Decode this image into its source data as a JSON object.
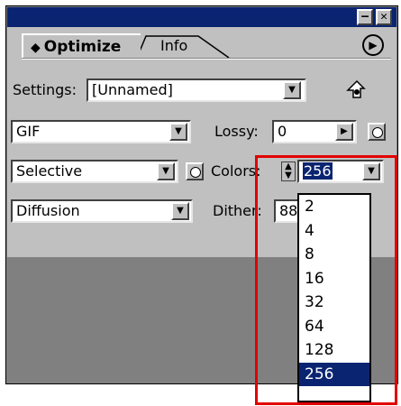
{
  "window": {
    "minimize_glyph": "–",
    "close_glyph": "✕"
  },
  "tabs": {
    "active_label": "Optimize",
    "active_glyph": "◆",
    "inactive_label": "Info",
    "menu_glyph": "▶"
  },
  "settings": {
    "label": "Settings:",
    "value": "[Unnamed]"
  },
  "format": {
    "value": "GIF"
  },
  "lossy": {
    "label": "Lossy:",
    "value": "0",
    "arrow": "▶"
  },
  "palette": {
    "value": "Selective"
  },
  "colors": {
    "label": "Colors:",
    "value": "256",
    "options": [
      "2",
      "4",
      "8",
      "16",
      "32",
      "64",
      "128",
      "256"
    ],
    "selected": "256"
  },
  "dither": {
    "method": "Diffusion",
    "label": "Dither:",
    "value": "88"
  },
  "dropdown_arrow": "▼",
  "colors_ui": {
    "titlebar": "#0b2471",
    "panel": "#c0c0c0",
    "selection": "#0b2471",
    "annotation": "#e20000"
  }
}
